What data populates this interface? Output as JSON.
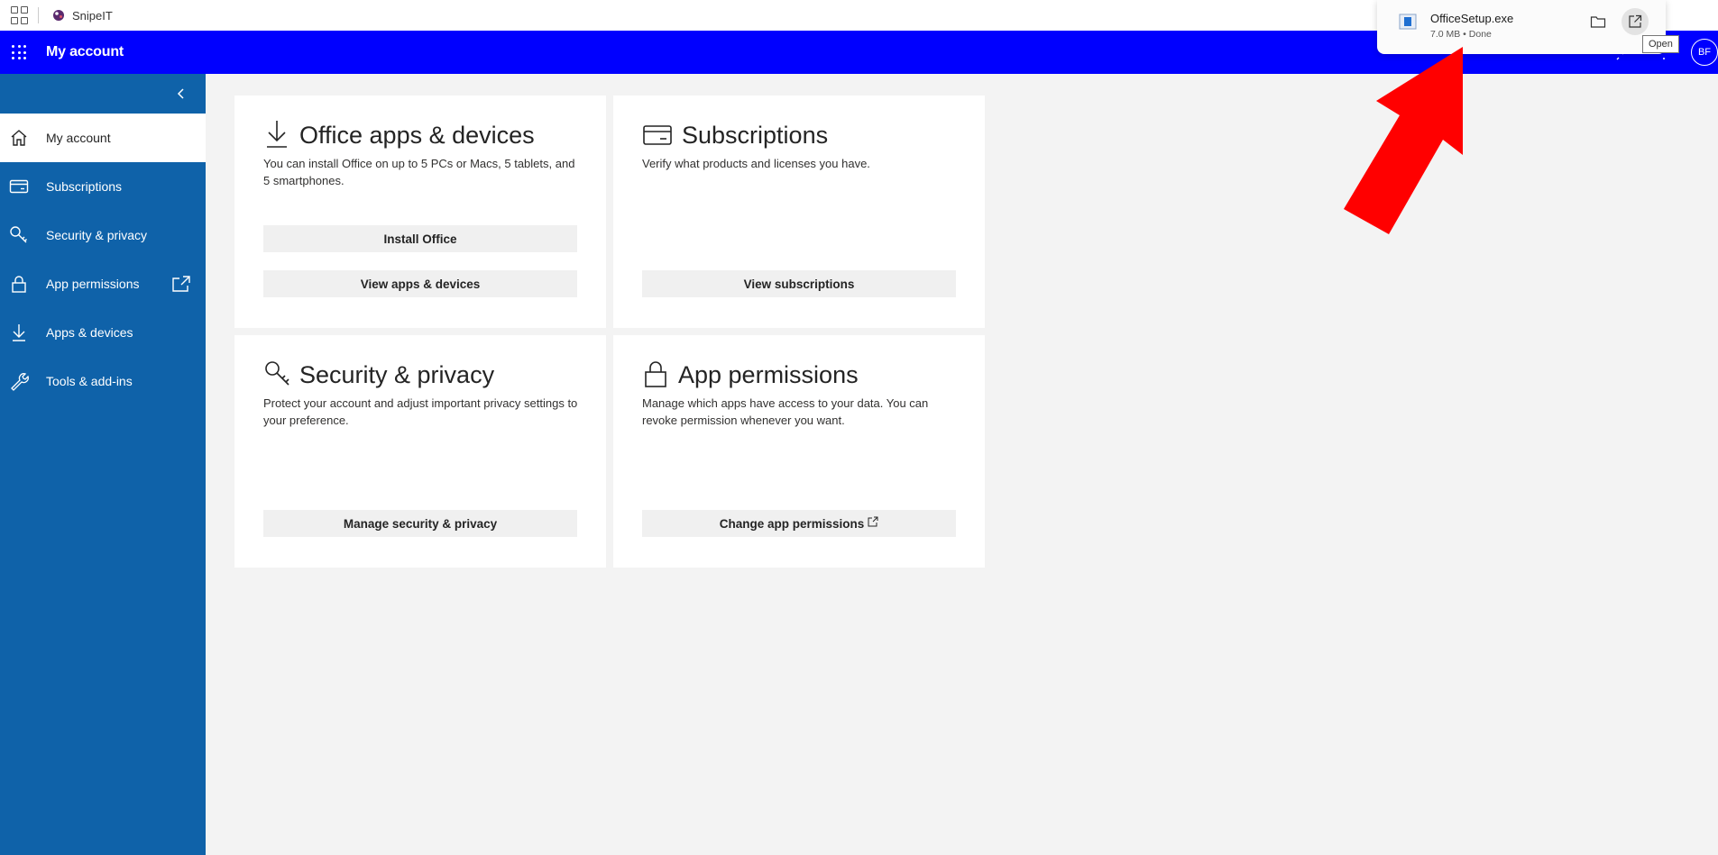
{
  "bookmark_bar": {
    "bookmark_label": "SnipeIT"
  },
  "header": {
    "title": "My account",
    "avatar_initials": "BF",
    "accent": "#0000ff"
  },
  "sidebar": {
    "color": "#0f62a9",
    "items": [
      {
        "label": "My account",
        "icon": "home-icon",
        "active": true
      },
      {
        "label": "Subscriptions",
        "icon": "card-icon"
      },
      {
        "label": "Security & privacy",
        "icon": "key-icon"
      },
      {
        "label": "App permissions",
        "icon": "lock-icon",
        "external": true
      },
      {
        "label": "Apps & devices",
        "icon": "download-icon"
      },
      {
        "label": "Tools & add-ins",
        "icon": "wrench-icon"
      }
    ]
  },
  "cards": {
    "office": {
      "title": "Office apps & devices",
      "desc": "You can install Office on up to 5 PCs or Macs, 5 tablets, and 5 smartphones.",
      "btn1": "Install Office",
      "btn2": "View apps & devices"
    },
    "subscriptions": {
      "title": "Subscriptions",
      "desc": "Verify what products and licenses you have.",
      "btn": "View subscriptions"
    },
    "security": {
      "title": "Security & privacy",
      "desc": "Protect your account and adjust important privacy settings to your preference.",
      "btn": "Manage security & privacy"
    },
    "permissions": {
      "title": "App permissions",
      "desc": "Manage which apps have access to your data. You can revoke permission whenever you want.",
      "btn": "Change app permissions"
    }
  },
  "download": {
    "file_name": "OfficeSetup.exe",
    "meta": "7.0 MB • Done",
    "tooltip": "Open"
  },
  "annotation_color": "#ff0000"
}
